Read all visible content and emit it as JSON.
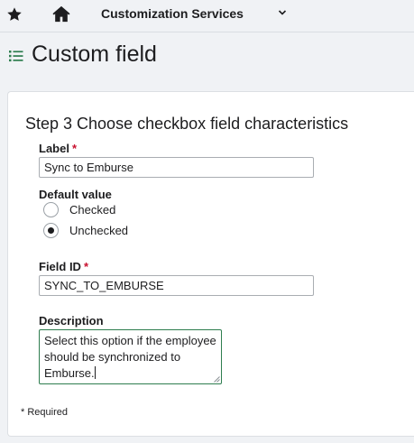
{
  "topbar": {
    "star_icon": "star-icon",
    "home_icon": "home-icon",
    "nav_title": "Customization Services",
    "chevron_icon": "chevron-down-icon"
  },
  "header": {
    "list_icon": "list-icon",
    "title": "Custom field",
    "accent_color": "#2e7d4f"
  },
  "form": {
    "step_title": "Step 3 Choose checkbox field characteristics",
    "label": {
      "text": "Label",
      "required_mark": "*",
      "value": "Sync to Emburse"
    },
    "default_value": {
      "text": "Default value",
      "options": [
        {
          "label": "Checked",
          "selected": false
        },
        {
          "label": "Unchecked",
          "selected": true
        }
      ]
    },
    "field_id": {
      "text": "Field ID",
      "required_mark": "*",
      "value": "SYNC_TO_EMBURSE"
    },
    "description": {
      "text": "Description",
      "value": "Select this option if the employee should be synchronized to Emburse."
    },
    "required_note": "* Required"
  },
  "colors": {
    "required": "#c8102e",
    "focus_border": "#2e7d4f"
  }
}
